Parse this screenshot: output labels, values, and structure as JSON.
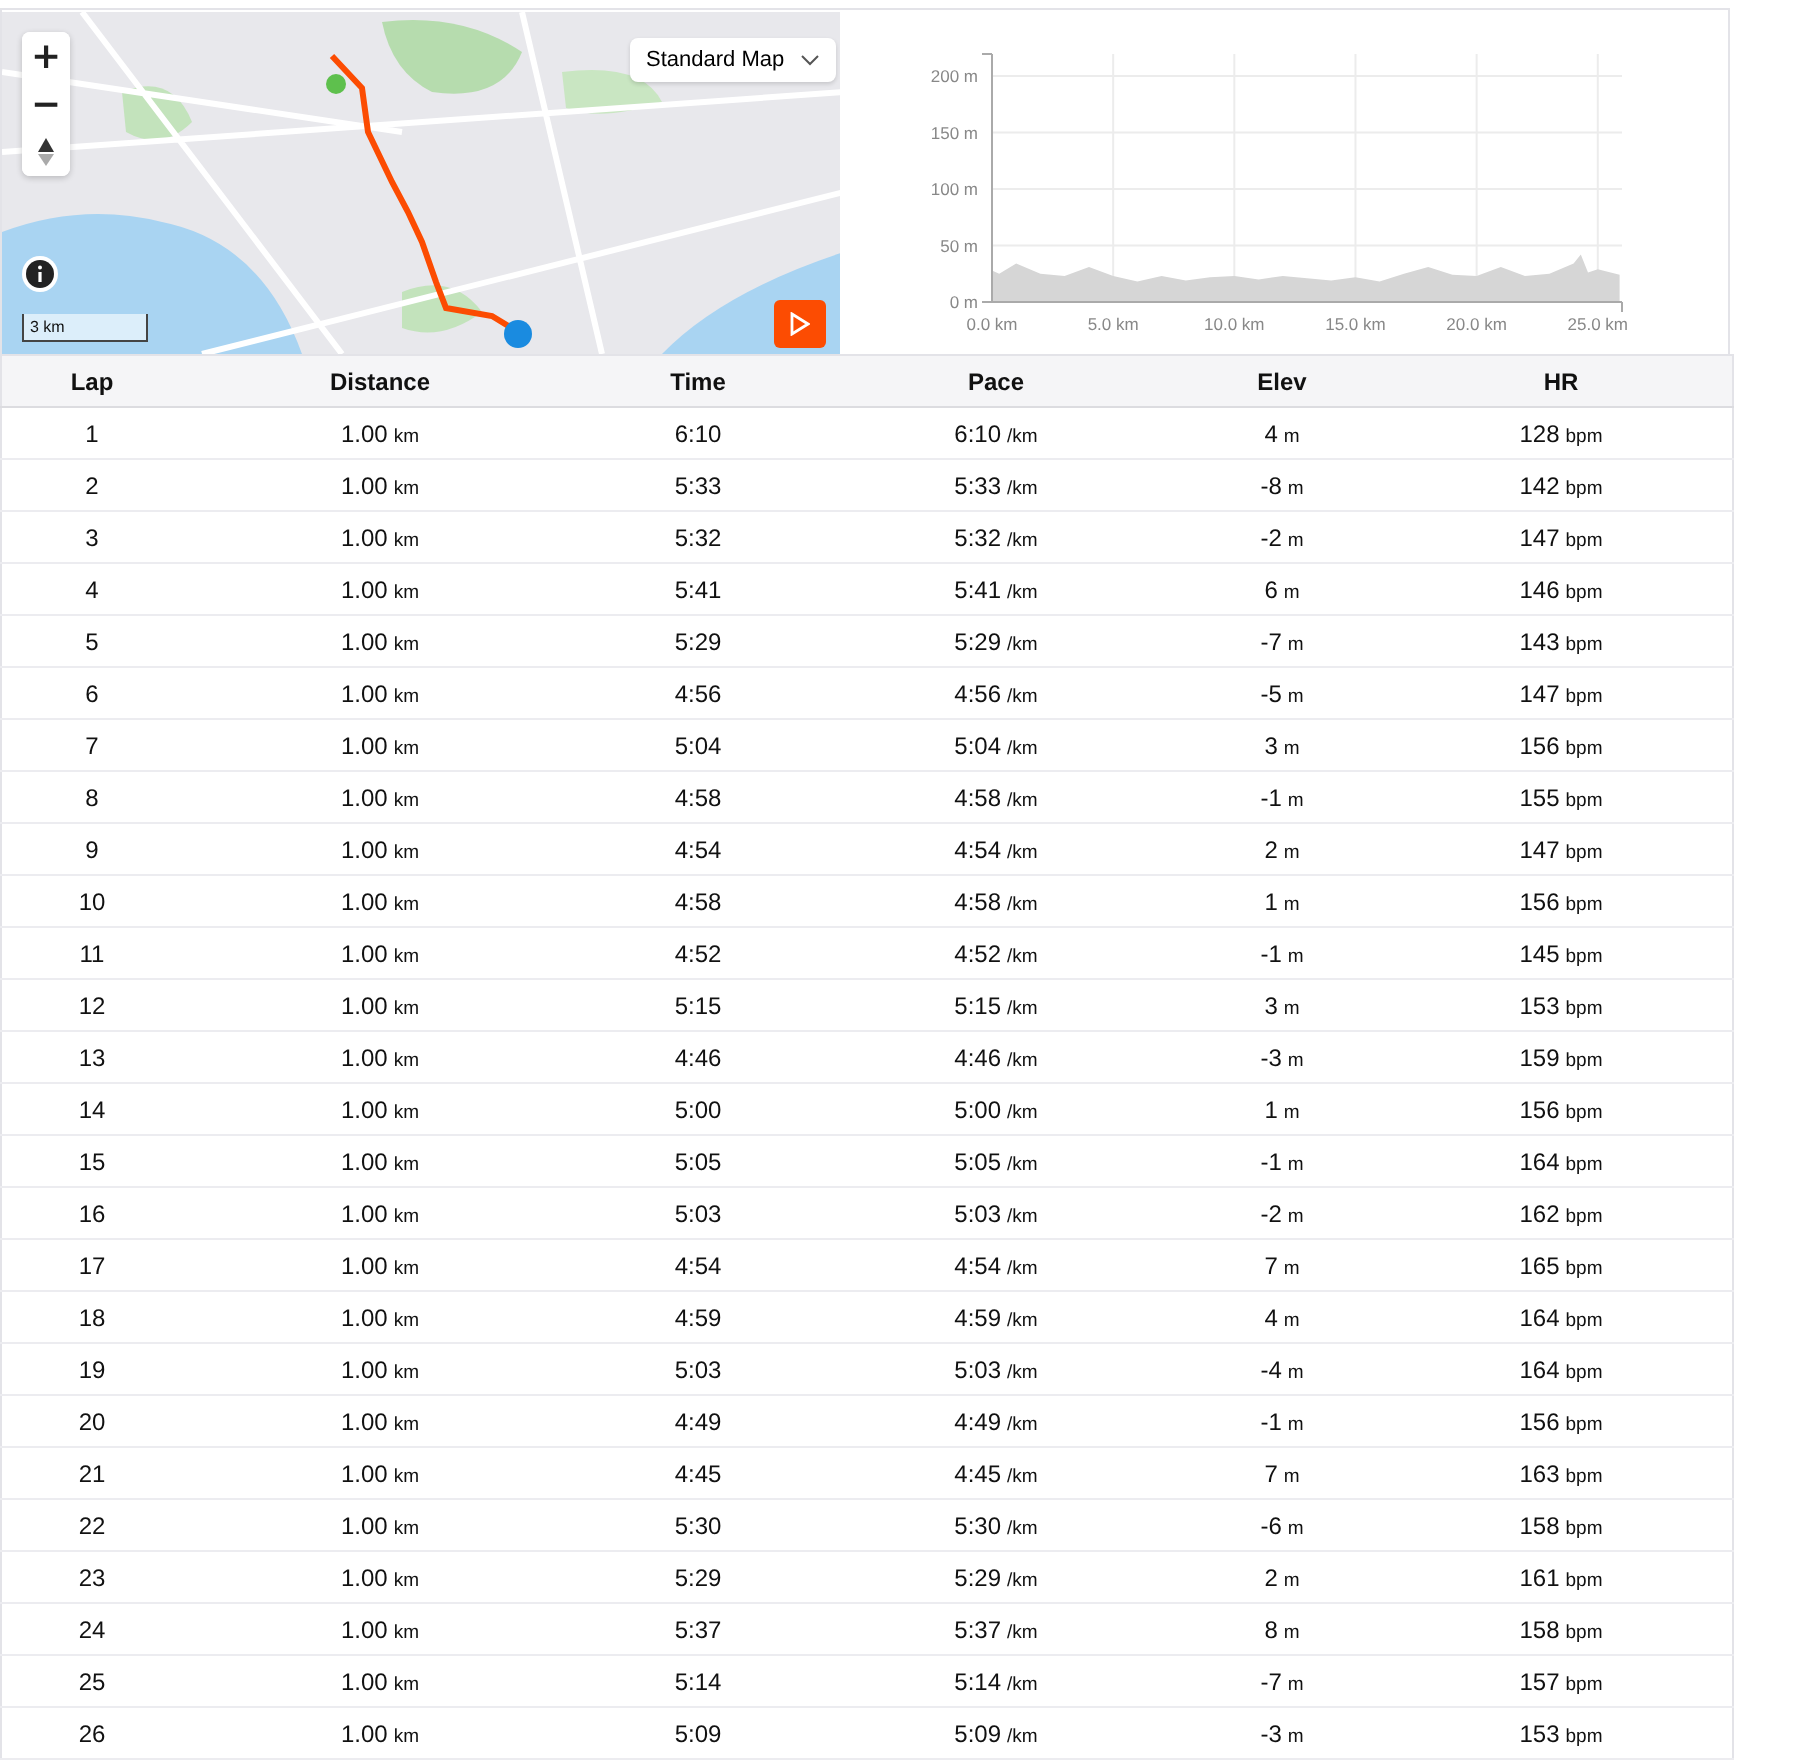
{
  "map": {
    "zoom_in": "+",
    "zoom_out": "−",
    "map_type": "Standard Map",
    "scale": "3 km"
  },
  "elevation_chart": {
    "chart_data": {
      "type": "area",
      "x": [
        0,
        0.3,
        1,
        2,
        3,
        4,
        5,
        6,
        7,
        8,
        9,
        10,
        11,
        12,
        13,
        14,
        15,
        16,
        17,
        18,
        19,
        20,
        21,
        22,
        23,
        24,
        24.3,
        24.6,
        25,
        25.9
      ],
      "series": [
        {
          "color": "#d6d6d6",
          "values": [
            28,
            25,
            34,
            25,
            23,
            31,
            23,
            18,
            23,
            19,
            22,
            23,
            20,
            23,
            21,
            19,
            22,
            18,
            25,
            31,
            24,
            23,
            31,
            23,
            25,
            34,
            42,
            26,
            29,
            24
          ]
        }
      ],
      "xlim": [
        0,
        26
      ],
      "ylim": [
        0,
        200
      ],
      "grid": true,
      "xticks": [
        {
          "value": 0,
          "label": "0.0 km"
        },
        {
          "value": 5,
          "label": "5.0 km"
        },
        {
          "value": 10,
          "label": "10.0 km"
        },
        {
          "value": 15,
          "label": "15.0 km"
        },
        {
          "value": 20,
          "label": "20.0 km"
        },
        {
          "value": 25,
          "label": "25.0 km"
        }
      ],
      "yticks": [
        {
          "value": 0,
          "label": "0 m"
        },
        {
          "value": 50,
          "label": "50 m"
        },
        {
          "value": 100,
          "label": "100 m"
        },
        {
          "value": 150,
          "label": "150 m"
        },
        {
          "value": 200,
          "label": "200 m"
        }
      ]
    }
  },
  "laps_table": {
    "columns": [
      "Lap",
      "Distance",
      "Time",
      "Pace",
      "Elev",
      "HR"
    ],
    "rows": [
      [
        {
          "value": "1"
        },
        {
          "value": "1.00",
          "unit": "km"
        },
        {
          "value": "6:10"
        },
        {
          "value": "6:10",
          "unit": "/km"
        },
        {
          "value": "4",
          "unit": "m"
        },
        {
          "value": "128",
          "unit": "bpm"
        }
      ],
      [
        {
          "value": "2"
        },
        {
          "value": "1.00",
          "unit": "km"
        },
        {
          "value": "5:33"
        },
        {
          "value": "5:33",
          "unit": "/km"
        },
        {
          "value": "-8",
          "unit": "m"
        },
        {
          "value": "142",
          "unit": "bpm"
        }
      ],
      [
        {
          "value": "3"
        },
        {
          "value": "1.00",
          "unit": "km"
        },
        {
          "value": "5:32"
        },
        {
          "value": "5:32",
          "unit": "/km"
        },
        {
          "value": "-2",
          "unit": "m"
        },
        {
          "value": "147",
          "unit": "bpm"
        }
      ],
      [
        {
          "value": "4"
        },
        {
          "value": "1.00",
          "unit": "km"
        },
        {
          "value": "5:41"
        },
        {
          "value": "5:41",
          "unit": "/km"
        },
        {
          "value": "6",
          "unit": "m"
        },
        {
          "value": "146",
          "unit": "bpm"
        }
      ],
      [
        {
          "value": "5"
        },
        {
          "value": "1.00",
          "unit": "km"
        },
        {
          "value": "5:29"
        },
        {
          "value": "5:29",
          "unit": "/km"
        },
        {
          "value": "-7",
          "unit": "m"
        },
        {
          "value": "143",
          "unit": "bpm"
        }
      ],
      [
        {
          "value": "6"
        },
        {
          "value": "1.00",
          "unit": "km"
        },
        {
          "value": "4:56"
        },
        {
          "value": "4:56",
          "unit": "/km"
        },
        {
          "value": "-5",
          "unit": "m"
        },
        {
          "value": "147",
          "unit": "bpm"
        }
      ],
      [
        {
          "value": "7"
        },
        {
          "value": "1.00",
          "unit": "km"
        },
        {
          "value": "5:04"
        },
        {
          "value": "5:04",
          "unit": "/km"
        },
        {
          "value": "3",
          "unit": "m"
        },
        {
          "value": "156",
          "unit": "bpm"
        }
      ],
      [
        {
          "value": "8"
        },
        {
          "value": "1.00",
          "unit": "km"
        },
        {
          "value": "4:58"
        },
        {
          "value": "4:58",
          "unit": "/km"
        },
        {
          "value": "-1",
          "unit": "m"
        },
        {
          "value": "155",
          "unit": "bpm"
        }
      ],
      [
        {
          "value": "9"
        },
        {
          "value": "1.00",
          "unit": "km"
        },
        {
          "value": "4:54"
        },
        {
          "value": "4:54",
          "unit": "/km"
        },
        {
          "value": "2",
          "unit": "m"
        },
        {
          "value": "147",
          "unit": "bpm"
        }
      ],
      [
        {
          "value": "10"
        },
        {
          "value": "1.00",
          "unit": "km"
        },
        {
          "value": "4:58"
        },
        {
          "value": "4:58",
          "unit": "/km"
        },
        {
          "value": "1",
          "unit": "m"
        },
        {
          "value": "156",
          "unit": "bpm"
        }
      ],
      [
        {
          "value": "11"
        },
        {
          "value": "1.00",
          "unit": "km"
        },
        {
          "value": "4:52"
        },
        {
          "value": "4:52",
          "unit": "/km"
        },
        {
          "value": "-1",
          "unit": "m"
        },
        {
          "value": "145",
          "unit": "bpm"
        }
      ],
      [
        {
          "value": "12"
        },
        {
          "value": "1.00",
          "unit": "km"
        },
        {
          "value": "5:15"
        },
        {
          "value": "5:15",
          "unit": "/km"
        },
        {
          "value": "3",
          "unit": "m"
        },
        {
          "value": "153",
          "unit": "bpm"
        }
      ],
      [
        {
          "value": "13"
        },
        {
          "value": "1.00",
          "unit": "km"
        },
        {
          "value": "4:46"
        },
        {
          "value": "4:46",
          "unit": "/km"
        },
        {
          "value": "-3",
          "unit": "m"
        },
        {
          "value": "159",
          "unit": "bpm"
        }
      ],
      [
        {
          "value": "14"
        },
        {
          "value": "1.00",
          "unit": "km"
        },
        {
          "value": "5:00"
        },
        {
          "value": "5:00",
          "unit": "/km"
        },
        {
          "value": "1",
          "unit": "m"
        },
        {
          "value": "156",
          "unit": "bpm"
        }
      ],
      [
        {
          "value": "15"
        },
        {
          "value": "1.00",
          "unit": "km"
        },
        {
          "value": "5:05"
        },
        {
          "value": "5:05",
          "unit": "/km"
        },
        {
          "value": "-1",
          "unit": "m"
        },
        {
          "value": "164",
          "unit": "bpm"
        }
      ],
      [
        {
          "value": "16"
        },
        {
          "value": "1.00",
          "unit": "km"
        },
        {
          "value": "5:03"
        },
        {
          "value": "5:03",
          "unit": "/km"
        },
        {
          "value": "-2",
          "unit": "m"
        },
        {
          "value": "162",
          "unit": "bpm"
        }
      ],
      [
        {
          "value": "17"
        },
        {
          "value": "1.00",
          "unit": "km"
        },
        {
          "value": "4:54"
        },
        {
          "value": "4:54",
          "unit": "/km"
        },
        {
          "value": "7",
          "unit": "m"
        },
        {
          "value": "165",
          "unit": "bpm"
        }
      ],
      [
        {
          "value": "18"
        },
        {
          "value": "1.00",
          "unit": "km"
        },
        {
          "value": "4:59"
        },
        {
          "value": "4:59",
          "unit": "/km"
        },
        {
          "value": "4",
          "unit": "m"
        },
        {
          "value": "164",
          "unit": "bpm"
        }
      ],
      [
        {
          "value": "19"
        },
        {
          "value": "1.00",
          "unit": "km"
        },
        {
          "value": "5:03"
        },
        {
          "value": "5:03",
          "unit": "/km"
        },
        {
          "value": "-4",
          "unit": "m"
        },
        {
          "value": "164",
          "unit": "bpm"
        }
      ],
      [
        {
          "value": "20"
        },
        {
          "value": "1.00",
          "unit": "km"
        },
        {
          "value": "4:49"
        },
        {
          "value": "4:49",
          "unit": "/km"
        },
        {
          "value": "-1",
          "unit": "m"
        },
        {
          "value": "156",
          "unit": "bpm"
        }
      ],
      [
        {
          "value": "21"
        },
        {
          "value": "1.00",
          "unit": "km"
        },
        {
          "value": "4:45"
        },
        {
          "value": "4:45",
          "unit": "/km"
        },
        {
          "value": "7",
          "unit": "m"
        },
        {
          "value": "163",
          "unit": "bpm"
        }
      ],
      [
        {
          "value": "22"
        },
        {
          "value": "1.00",
          "unit": "km"
        },
        {
          "value": "5:30"
        },
        {
          "value": "5:30",
          "unit": "/km"
        },
        {
          "value": "-6",
          "unit": "m"
        },
        {
          "value": "158",
          "unit": "bpm"
        }
      ],
      [
        {
          "value": "23"
        },
        {
          "value": "1.00",
          "unit": "km"
        },
        {
          "value": "5:29"
        },
        {
          "value": "5:29",
          "unit": "/km"
        },
        {
          "value": "2",
          "unit": "m"
        },
        {
          "value": "161",
          "unit": "bpm"
        }
      ],
      [
        {
          "value": "24"
        },
        {
          "value": "1.00",
          "unit": "km"
        },
        {
          "value": "5:37"
        },
        {
          "value": "5:37",
          "unit": "/km"
        },
        {
          "value": "8",
          "unit": "m"
        },
        {
          "value": "158",
          "unit": "bpm"
        }
      ],
      [
        {
          "value": "25"
        },
        {
          "value": "1.00",
          "unit": "km"
        },
        {
          "value": "5:14"
        },
        {
          "value": "5:14",
          "unit": "/km"
        },
        {
          "value": "-7",
          "unit": "m"
        },
        {
          "value": "157",
          "unit": "bpm"
        }
      ],
      [
        {
          "value": "26"
        },
        {
          "value": "1.00",
          "unit": "km"
        },
        {
          "value": "5:09"
        },
        {
          "value": "5:09",
          "unit": "/km"
        },
        {
          "value": "-3",
          "unit": "m"
        },
        {
          "value": "153",
          "unit": "bpm"
        }
      ]
    ]
  }
}
